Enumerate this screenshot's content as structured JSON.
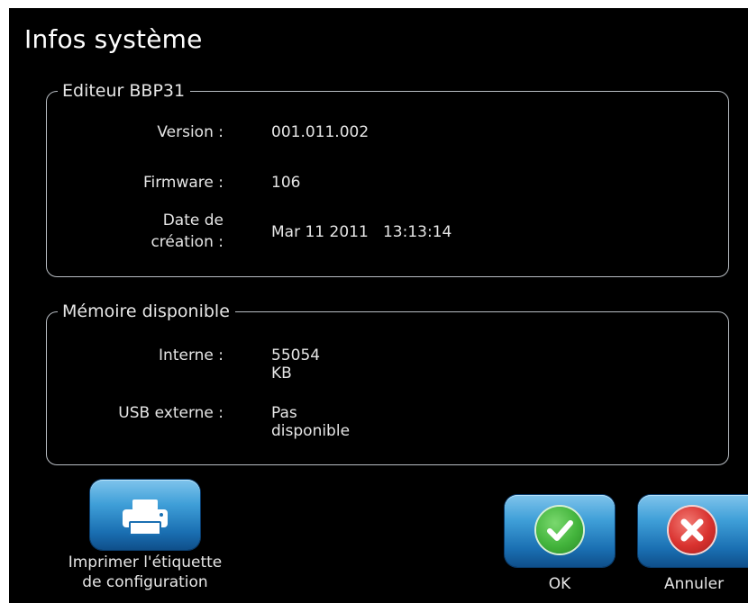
{
  "dialog": {
    "title": "Infos système"
  },
  "editor_group": {
    "legend": "Editeur BBP31",
    "version_label": "Version :",
    "version_value": "001.011.002",
    "firmware_label": "Firmware :",
    "firmware_value": "106",
    "date_label_line1": "Date de",
    "date_label_line2": "création :",
    "date_value": "Mar 11 2011   13:13:14"
  },
  "memory_group": {
    "legend": "Mémoire disponible",
    "internal_label": "Interne :",
    "internal_value": "55054 KB",
    "usb_label": "USB externe :",
    "usb_value": "Pas disponible"
  },
  "buttons": {
    "print_icon": "printer-icon",
    "print_label_line1": "Imprimer l'étiquette",
    "print_label_line2": "de configuration",
    "ok_icon": "checkmark-icon",
    "ok_label": "OK",
    "cancel_icon": "close-icon",
    "cancel_label": "Annuler"
  },
  "colors": {
    "background": "#000000",
    "button_blue": "#2a8ccf",
    "ok_green": "#43b43c",
    "cancel_red": "#d9322f"
  }
}
